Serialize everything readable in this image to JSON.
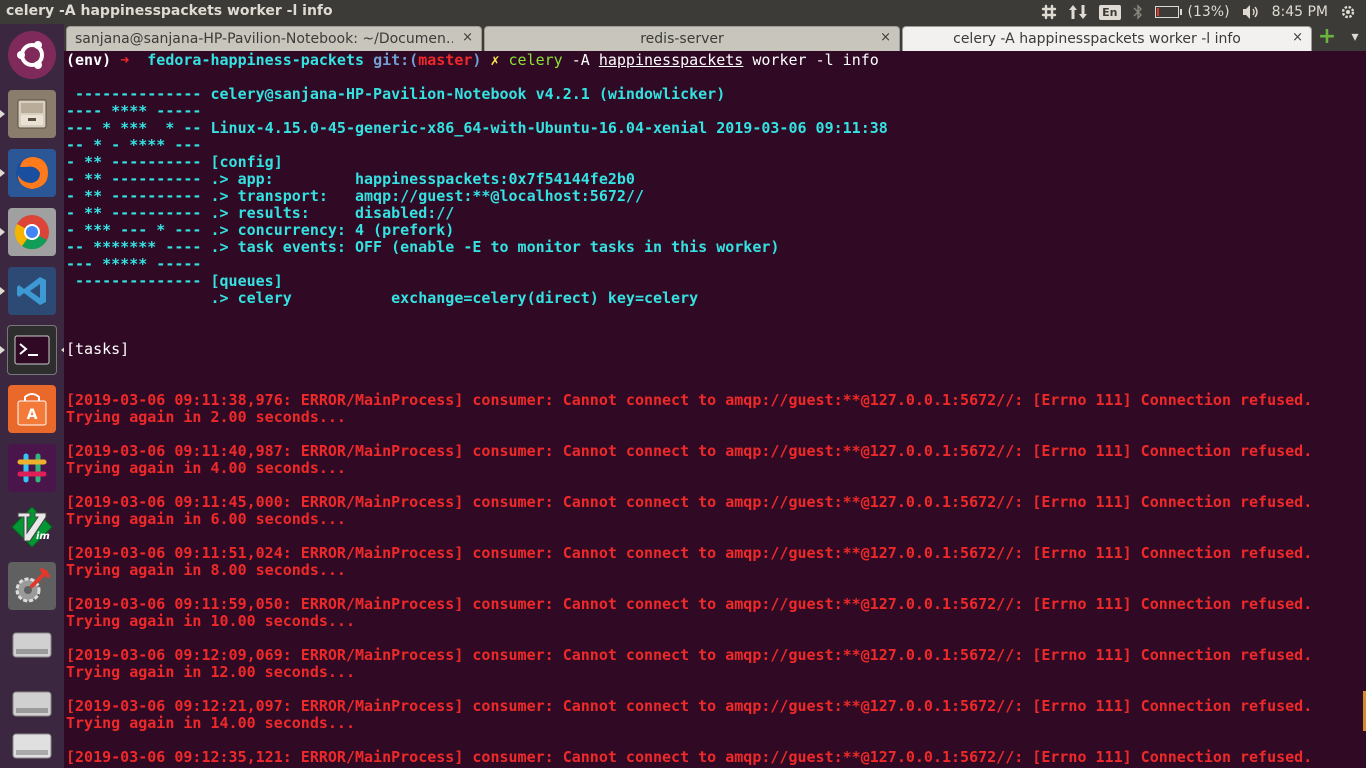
{
  "window": {
    "title": "celery -A happinesspackets worker -l info"
  },
  "panel": {
    "lang": "En",
    "battery_text": "(13%)",
    "battery_level": 0.13,
    "time": "8:45 PM",
    "icons": [
      "slack-icon",
      "network-transfer-icon",
      "keyboard-layout-icon",
      "bluetooth-icon",
      "battery-icon",
      "volume-icon",
      "power-gear-icon"
    ]
  },
  "launcher": {
    "items": [
      {
        "name": "ubuntu-dash",
        "icon": "ubuntu-logo-icon"
      },
      {
        "name": "files",
        "icon": "file-cabinet-icon"
      },
      {
        "name": "firefox",
        "icon": "firefox-icon"
      },
      {
        "name": "chrome",
        "icon": "chrome-icon"
      },
      {
        "name": "vscode",
        "icon": "vscode-icon"
      },
      {
        "name": "terminal",
        "icon": "terminal-icon"
      },
      {
        "name": "software-center",
        "icon": "shopping-bag-icon"
      },
      {
        "name": "slack",
        "icon": "slack-icon"
      },
      {
        "name": "vim",
        "icon": "vim-icon"
      },
      {
        "name": "system-settings",
        "icon": "wrench-gear-icon"
      },
      {
        "name": "drive-1",
        "icon": "hard-drive-icon"
      },
      {
        "name": "drive-2",
        "icon": "hard-drive-icon"
      },
      {
        "name": "drive-3",
        "icon": "hard-drive-icon"
      }
    ]
  },
  "tabs": [
    {
      "label": "sanjana@sanjana-HP-Pavilion-Notebook: ~/Documen…",
      "close": "×"
    },
    {
      "label": "redis-server",
      "close": "×"
    },
    {
      "label": "celery -A happinesspackets worker -l info",
      "close": "×"
    }
  ],
  "tab_actions": {
    "new_tab": "+",
    "menu": "▾"
  },
  "terminal": {
    "prompt": {
      "env": "(env) ",
      "arrow": "➜  ",
      "dir": "fedora-happiness-packets ",
      "git_prefix": "git:(",
      "branch": "master",
      "git_suffix": ") ",
      "dirty": "✗ ",
      "cmd": "celery",
      "arg1": " -A ",
      "app": "happinesspackets",
      "rest": " worker -l info"
    },
    "banner": [
      " -------------- celery@sanjana-HP-Pavilion-Notebook v4.2.1 (windowlicker)",
      "---- **** -----",
      "--- * ***  * -- Linux-4.15.0-45-generic-x86_64-with-Ubuntu-16.04-xenial 2019-03-06 09:11:38",
      "-- * - **** ---",
      "- ** ---------- [config]",
      "- ** ---------- .> app:         happinesspackets:0x7f54144fe2b0",
      "- ** ---------- .> transport:   amqp://guest:**@localhost:5672//",
      "- ** ---------- .> results:     disabled://",
      "- *** --- * --- .> concurrency: 4 (prefork)",
      "-- ******* ---- .> task events: OFF (enable -E to monitor tasks in this worker)",
      "--- ***** -----",
      " -------------- [queues]",
      "                .> celery           exchange=celery(direct) key=celery"
    ],
    "tasks_header": "[tasks]",
    "errors": [
      {
        "log": "[2019-03-06 09:11:38,976: ERROR/MainProcess] consumer: Cannot connect to amqp://guest:**@127.0.0.1:5672//: [Errno 111] Connection refused.",
        "retry": "Trying again in 2.00 seconds..."
      },
      {
        "log": "[2019-03-06 09:11:40,987: ERROR/MainProcess] consumer: Cannot connect to amqp://guest:**@127.0.0.1:5672//: [Errno 111] Connection refused.",
        "retry": "Trying again in 4.00 seconds..."
      },
      {
        "log": "[2019-03-06 09:11:45,000: ERROR/MainProcess] consumer: Cannot connect to amqp://guest:**@127.0.0.1:5672//: [Errno 111] Connection refused.",
        "retry": "Trying again in 6.00 seconds..."
      },
      {
        "log": "[2019-03-06 09:11:51,024: ERROR/MainProcess] consumer: Cannot connect to amqp://guest:**@127.0.0.1:5672//: [Errno 111] Connection refused.",
        "retry": "Trying again in 8.00 seconds..."
      },
      {
        "log": "[2019-03-06 09:11:59,050: ERROR/MainProcess] consumer: Cannot connect to amqp://guest:**@127.0.0.1:5672//: [Errno 111] Connection refused.",
        "retry": "Trying again in 10.00 seconds..."
      },
      {
        "log": "[2019-03-06 09:12:09,069: ERROR/MainProcess] consumer: Cannot connect to amqp://guest:**@127.0.0.1:5672//: [Errno 111] Connection refused.",
        "retry": "Trying again in 12.00 seconds..."
      },
      {
        "log": "[2019-03-06 09:12:21,097: ERROR/MainProcess] consumer: Cannot connect to amqp://guest:**@127.0.0.1:5672//: [Errno 111] Connection refused.",
        "retry": "Trying again in 14.00 seconds..."
      },
      {
        "log": "[2019-03-06 09:12:35,121: ERROR/MainProcess] consumer: Cannot connect to amqp://guest:**@127.0.0.1:5672//: [Errno 111] Connection refused.",
        "retry": ""
      }
    ]
  },
  "colors": {
    "terminal_bg": "#300a24",
    "banner": "#34e2e2",
    "error": "#ef2929",
    "branch": "#ef2929",
    "dirty": "#fce94f",
    "prompt_dir": "#34e2e2",
    "cmd": "#8ae234"
  }
}
